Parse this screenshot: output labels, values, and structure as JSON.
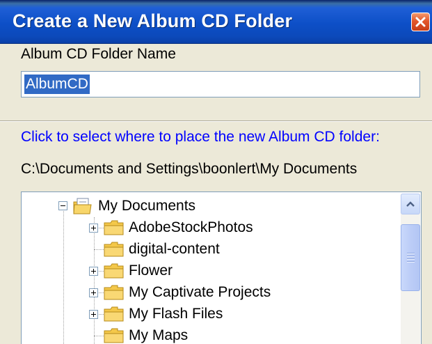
{
  "dialog": {
    "title": "Create a New Album CD Folder",
    "name_label": "Album CD Folder Name",
    "name_value": "AlbumCD",
    "location_prompt": "Click to select where to place the new Album CD folder:",
    "current_path": "C:\\Documents and Settings\\boonlert\\My Documents"
  },
  "tree": {
    "root": {
      "label": "My Documents",
      "icon": "documents-folder-icon",
      "expanded": true
    },
    "items": [
      {
        "label": "AdobeStockPhotos",
        "has_children": true
      },
      {
        "label": "digital-content",
        "has_children": false
      },
      {
        "label": "Flower",
        "has_children": true
      },
      {
        "label": "My Captivate Projects",
        "has_children": true
      },
      {
        "label": "My Flash Files",
        "has_children": true
      },
      {
        "label": "My Maps",
        "has_children": false
      }
    ]
  },
  "colors": {
    "titlebar": "#0d4fc7",
    "close_button": "#e2572b",
    "dialog_background": "#ece9d8",
    "prompt_text": "#0000ff",
    "selection": "#316ac5",
    "folder": "#f4c84a"
  }
}
